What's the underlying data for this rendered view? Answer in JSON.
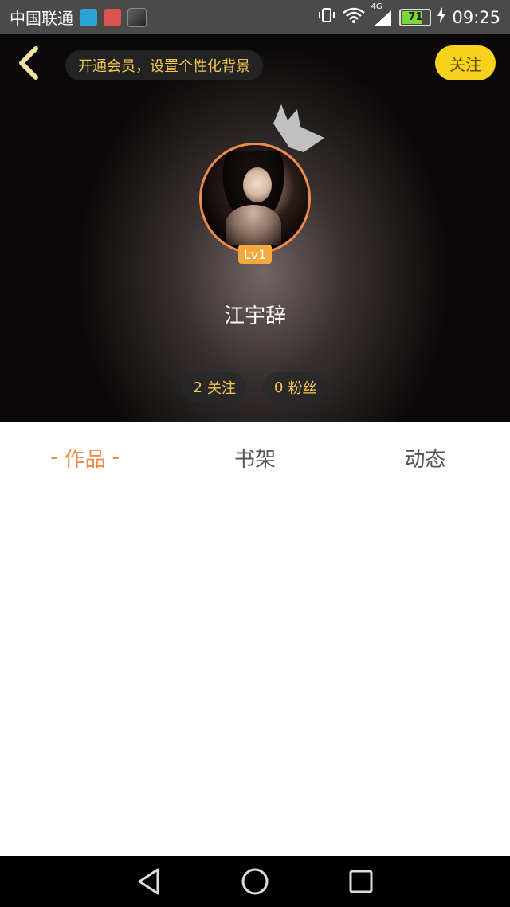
{
  "status_bar": {
    "carrier": "中国联通",
    "network": "4G",
    "battery": "71",
    "time": "09:25",
    "icons": [
      "blue-app-icon",
      "red-app-icon",
      "photo-thumbnail-icon",
      "vibrate-icon",
      "wifi-icon",
      "signal-icon",
      "battery-icon",
      "charging-icon"
    ]
  },
  "header": {
    "vip_banner": "开通会员，设置个性化背景",
    "follow_label": "关注",
    "accent_color": "#f7d21c"
  },
  "profile": {
    "level": "Lv1",
    "name": "江宇辞",
    "following_count": "2",
    "following_label": "关注",
    "followers_count": "0",
    "followers_label": "粉丝"
  },
  "tabs": [
    {
      "label": "作品",
      "active": true,
      "color": "#f08a4b"
    },
    {
      "label": "书架",
      "active": false
    },
    {
      "label": "动态",
      "active": false
    }
  ],
  "tab_dash": "-",
  "nav": {
    "icons": [
      "back-triangle-icon",
      "home-circle-icon",
      "recents-square-icon"
    ]
  }
}
